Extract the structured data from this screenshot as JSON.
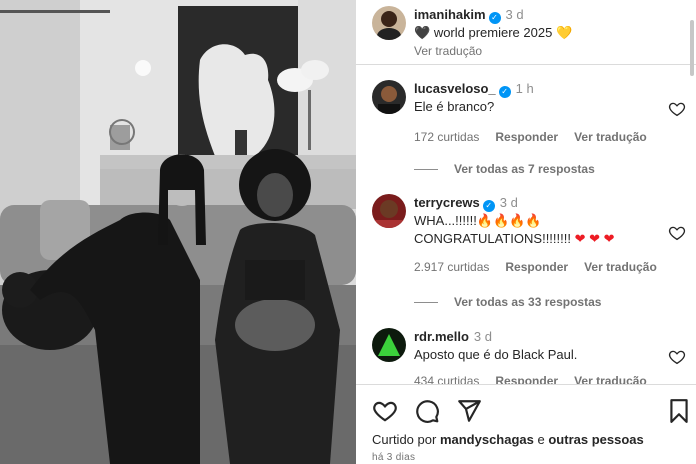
{
  "post": {
    "author": "imanihakim",
    "time": "3 d",
    "caption_prefix": "🖤",
    "caption_text": "world premiere 2025",
    "caption_suffix": "💛",
    "translate_label": "Ver tradução"
  },
  "comments": [
    {
      "username": "lucasveloso_",
      "verified": true,
      "time": "1 h",
      "text": "Ele é branco?",
      "likes": "172 curtidas",
      "reply_label": "Responder",
      "translate_label": "Ver tradução",
      "view_replies": "Ver todas as 7 respostas"
    },
    {
      "username": "terrycrews",
      "verified": true,
      "time": "3 d",
      "text_line1": "WHA...!!!!!!🔥🔥🔥🔥",
      "text_line2": "CONGRATULATIONS!!!!!!!!",
      "likes": "2.917 curtidas",
      "reply_label": "Responder",
      "translate_label": "Ver tradução",
      "view_replies": "Ver todas as 33 respostas"
    },
    {
      "username": "rdr.mello",
      "verified": false,
      "time": "3 d",
      "text": "Aposto que é do Black Paul.",
      "likes": "434 curtidas",
      "reply_label": "Responder",
      "translate_label": "Ver tradução"
    }
  ],
  "footer": {
    "liked_by_prefix": "Curtido por",
    "liked_by_user": "mandyschagas",
    "liked_by_mid": "e",
    "liked_by_others": "outras pessoas",
    "date": "há 3 dias"
  },
  "icons": {
    "like": "heart-outline-icon",
    "comment": "comment-icon",
    "share": "send-icon",
    "save": "bookmark-icon"
  },
  "colors": {
    "verified": "#0095f6",
    "text": "#262626",
    "muted": "#737373"
  }
}
